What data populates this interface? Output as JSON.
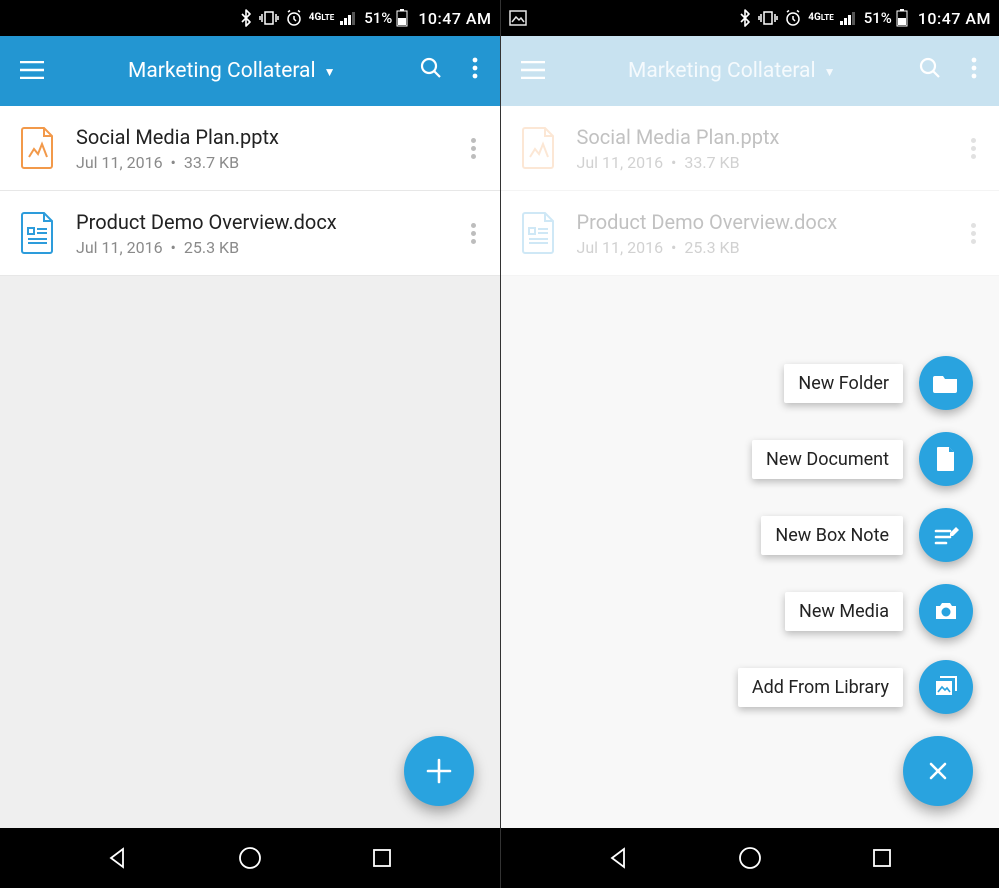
{
  "status": {
    "time": "10:47 AM",
    "battery_pct": "51%",
    "network_label": "4G LTE"
  },
  "appbar": {
    "folder_title": "Marketing Collateral"
  },
  "files": [
    {
      "name": "Social Media Plan.pptx",
      "date": "Jul 11, 2016",
      "size": "33.7 KB",
      "icon": "pptx",
      "icon_color": "#f2994a"
    },
    {
      "name": "Product Demo Overview.docx",
      "date": "Jul 11, 2016",
      "size": "25.3 KB",
      "icon": "docx",
      "icon_color": "#2d9cdb"
    }
  ],
  "fab_menu": [
    {
      "label": "New Folder",
      "icon": "folder"
    },
    {
      "label": "New Document",
      "icon": "doc"
    },
    {
      "label": "New Box Note",
      "icon": "note"
    },
    {
      "label": "New Media",
      "icon": "camera"
    },
    {
      "label": "Add From Library",
      "icon": "library"
    }
  ],
  "colors": {
    "appbar": "#2396d2",
    "appbar_dim": "#86bfde",
    "accent": "#29a3df"
  }
}
